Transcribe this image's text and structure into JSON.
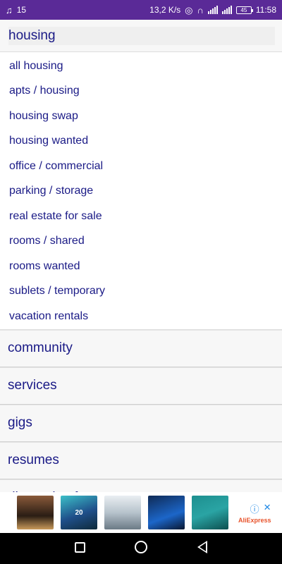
{
  "status_bar": {
    "music_icon": "music-note",
    "notification_count": "15",
    "network_speed": "13,2 K/s",
    "battery": "45",
    "time": "11:58"
  },
  "section": {
    "title": "housing",
    "items": [
      "all housing",
      "apts / housing",
      "housing swap",
      "housing wanted",
      "office / commercial",
      "parking / storage",
      "real estate for sale",
      "rooms / shared",
      "rooms wanted",
      "sublets / temporary",
      "vacation rentals"
    ]
  },
  "categories": [
    "community",
    "services",
    "gigs",
    "resumes",
    "discussion forums"
  ],
  "ad": {
    "brand": "AliExpress",
    "info_icon": "info-icon",
    "close_icon": "close-icon",
    "phone_label": "20"
  },
  "colors": {
    "status_bar": "#5a2a97",
    "link": "#1a1a86",
    "header_bg": "#f7f7f7"
  }
}
